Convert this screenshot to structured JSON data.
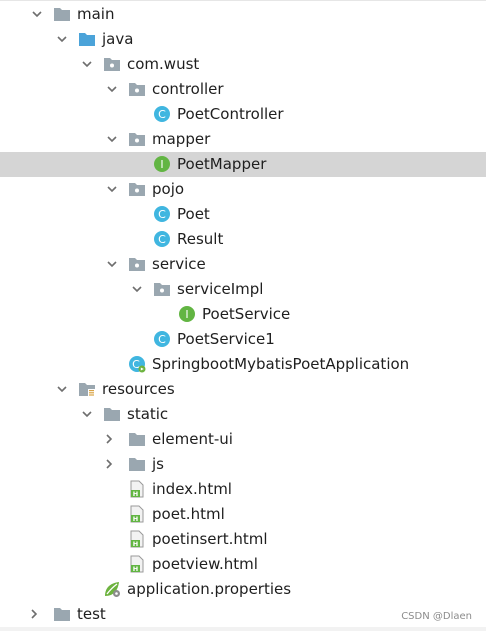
{
  "tree": {
    "items": [
      {
        "label": "main",
        "type": "folder",
        "expanded": true
      },
      {
        "label": "java",
        "type": "source-folder",
        "expanded": true
      },
      {
        "label": "com.wust",
        "type": "package",
        "expanded": true
      },
      {
        "label": "controller",
        "type": "package",
        "expanded": true
      },
      {
        "label": "PoetController",
        "type": "class"
      },
      {
        "label": "mapper",
        "type": "package",
        "expanded": true
      },
      {
        "label": "PoetMapper",
        "type": "interface",
        "selected": true
      },
      {
        "label": "pojo",
        "type": "package",
        "expanded": true
      },
      {
        "label": "Poet",
        "type": "class"
      },
      {
        "label": "Result",
        "type": "class"
      },
      {
        "label": "service",
        "type": "package",
        "expanded": true
      },
      {
        "label": "serviceImpl",
        "type": "package",
        "expanded": true
      },
      {
        "label": "PoetService",
        "type": "interface"
      },
      {
        "label": "PoetService1",
        "type": "class"
      },
      {
        "label": "SpringbootMybatisPoetApplication",
        "type": "spring-boot-class"
      },
      {
        "label": "resources",
        "type": "resources-folder",
        "expanded": true
      },
      {
        "label": "static",
        "type": "folder",
        "expanded": true
      },
      {
        "label": "element-ui",
        "type": "folder",
        "expanded": false
      },
      {
        "label": "js",
        "type": "folder",
        "expanded": false
      },
      {
        "label": "index.html",
        "type": "html-file"
      },
      {
        "label": "poet.html",
        "type": "html-file"
      },
      {
        "label": "poetinsert.html",
        "type": "html-file"
      },
      {
        "label": "poetview.html",
        "type": "html-file"
      },
      {
        "label": "application.properties",
        "type": "properties-file"
      },
      {
        "label": "test",
        "type": "folder",
        "expanded": false
      }
    ]
  },
  "watermark": {
    "text": "CSDN @Dlaen"
  },
  "colors": {
    "selection": "#d5d5d5",
    "folder": "#9aa7b0",
    "source_folder": "#4ba3d9",
    "class_icon": "#40b6e0",
    "interface_icon": "#62b543",
    "html_icon": "#62b543",
    "spring": "#6db33f",
    "chevron": "#6e6e6e"
  }
}
